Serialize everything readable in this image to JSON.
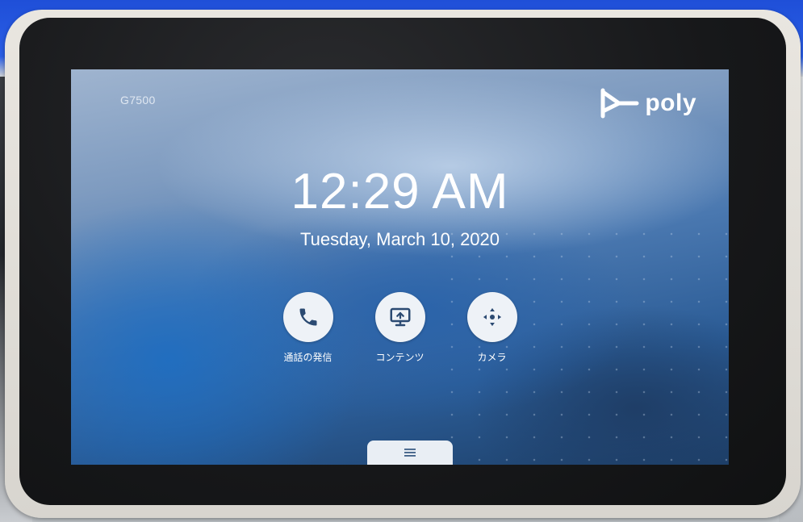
{
  "device": {
    "model": "G7500",
    "brand": "poly"
  },
  "home": {
    "time": "12:29 AM",
    "date": "Tuesday, March 10, 2020"
  },
  "actions": [
    {
      "icon": "phone-icon",
      "label": "通話の発信"
    },
    {
      "icon": "content-share-icon",
      "label": "コンテンツ"
    },
    {
      "icon": "camera-move-icon",
      "label": "カメラ"
    }
  ],
  "menu": {
    "icon": "menu-icon"
  },
  "colors": {
    "action_circle": "#eef2f7",
    "icon_dark": "#2b4a72",
    "text": "#ffffff"
  }
}
